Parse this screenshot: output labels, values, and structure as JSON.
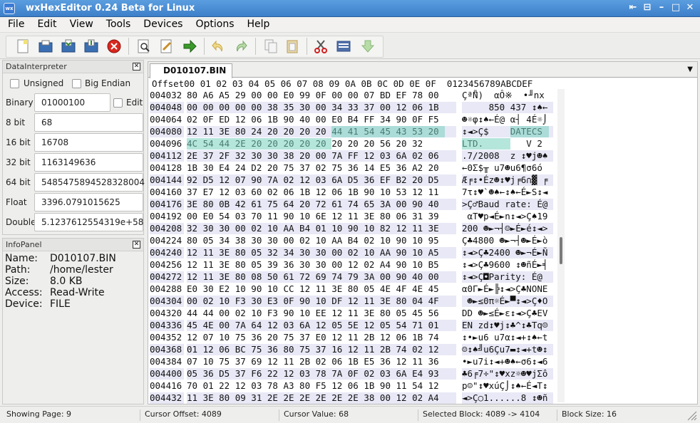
{
  "window": {
    "title": "wxHexEditor 0.24 Beta for Linux",
    "icon_text": "wx"
  },
  "menu": [
    "File",
    "Edit",
    "View",
    "Tools",
    "Devices",
    "Options",
    "Help"
  ],
  "toolbar": [
    "new-file",
    "open-file",
    "save-file",
    "save-as",
    "close-file",
    "find",
    "find-replace",
    "goto-offset",
    "undo",
    "redo",
    "copy",
    "paste",
    "cut",
    "device-memory",
    "download"
  ],
  "data_interpreter": {
    "title": "DataInterpreter",
    "unsigned_label": "Unsigned",
    "big_endian_label": "Big Endian",
    "edit_label": "Edit",
    "rows": [
      {
        "label": "Binary",
        "value": "01000100"
      },
      {
        "label": "8 bit",
        "value": "68"
      },
      {
        "label": "16 bit",
        "value": "16708"
      },
      {
        "label": "32 bit",
        "value": "1163149636"
      },
      {
        "label": "64 bit",
        "value": "5485475894528328004"
      },
      {
        "label": "Float",
        "value": "3396.0791015625"
      },
      {
        "label": "Double",
        "value": "5.1237612554319e+58"
      }
    ]
  },
  "info_panel": {
    "title": "InfoPanel",
    "rows": [
      {
        "key": "Name:",
        "value": "D010107.BIN"
      },
      {
        "key": "Path:",
        "value": "/home/lester"
      },
      {
        "key": "Size:",
        "value": "8.0 KB"
      },
      {
        "key": "Access:",
        "value": "Read-Write"
      },
      {
        "key": "Device:",
        "value": "FILE"
      }
    ]
  },
  "hex_view": {
    "tab": "D010107.BIN",
    "header": "Offset00 01 02 03 04 05 06 07 08 09 0A 0B 0C 0D 0E 0F  0123456789ABCDEF",
    "rows": [
      {
        "offset": "004032",
        "hex": "80 A6 A5 29 00 00 E0 99 0F 00 00 07 BD EF 78 00",
        "text": "Çª̃Ñ)  αÔ※  •╜nx"
      },
      {
        "offset": "004048",
        "hex": "00 00 00 00 00 38 35 30 00 34 33 37 00 12 06 1B",
        "text": "     850 437 ↕♠←"
      },
      {
        "offset": "004064",
        "hex": "02 0F ED 12 06 1B 90 40 00 E0 B4 FF 34 90 0F F5",
        "text": "☻☼φ↕♠←É@ α┤ 4É☼⌡"
      },
      {
        "offset": "004080",
        "hex": "12 11 3E 80 24 20 20 20 20 44 41 54 45 43 53 20",
        "text": "↕◄>Ç$    DATECS "
      },
      {
        "offset": "004096",
        "hex": "4C 54 44 2E 20 20 20 20 20 20 20 20 56 20 32",
        "text": "LTD.        V 2"
      },
      {
        "offset": "004112",
        "hex": "2E 37 2F 32 30 30 38 20 00 7A FF 12 03 6A 02 06",
        "text": ".7/2008  z ↕♥j☻♠"
      },
      {
        "offset": "004128",
        "hex": "1B 30 E4 24 D2 20 75 37 02 75 36 14 E5 36 A2 20",
        "text": "←0Σ$╥ u7☻u6¶σ6ó "
      },
      {
        "offset": "004144",
        "hex": "92 D5 12 07 90 7A 02 12 03 6A D5 36 EF B2 20 D5",
        "text": "Æ╒↕•Éz☻↕♥j╒6∩▓ ╒"
      },
      {
        "offset": "004160",
        "hex": "37 E7 12 03 60 02 06 1B 12 06 1B 90 10 53 12 11",
        "text": "7τ↕♥`☻♠←↕♠←É►S↕◄"
      },
      {
        "offset": "004176",
        "hex": "3E 80 0B 42 61 75 64 20 72 61 74 65 3A 00 90 40",
        "text": ">Ç♂Baud rate: É@"
      },
      {
        "offset": "004192",
        "hex": "00 E0 54 03 70 11 90 10 6E 12 11 3E 80 06 31 39",
        "text": " αT♥p◄É►n↕◄>Ç♠19"
      },
      {
        "offset": "004208",
        "hex": "32 30 30 00 02 10 AA B4 01 10 90 10 82 12 11 3E",
        "text": "200 ☻►¬┤☺►É►é↕◄>"
      },
      {
        "offset": "004224",
        "hex": "80 05 34 38 30 30 00 02 10 AA B4 02 10 90 10 95",
        "text": "Ç♣4800 ☻►¬┤☻►É►ò"
      },
      {
        "offset": "004240",
        "hex": "12 11 3E 80 05 32 34 30 30 00 02 10 AA 90 10 A5",
        "text": "↕◄>Ç♣2400 ☻►¬É►Ñ"
      },
      {
        "offset": "004256",
        "hex": "12 11 3E 80 05 39 36 30 30 00 12 02 A4 90 10 B5",
        "text": "↕◄>Ç♣9600 ↕☻ñÉ►╡"
      },
      {
        "offset": "004272",
        "hex": "12 11 3E 80 08 50 61 72 69 74 79 3A 00 90 40 00",
        "text": "↕◄>Ç◘Parity: É@ "
      },
      {
        "offset": "004288",
        "hex": "E0 30 E2 10 90 10 CC 12 11 3E 80 05 4E 4F 4E 45",
        "text": "α0Γ►É►╠↕◄>Ç♣NONE"
      },
      {
        "offset": "004304",
        "hex": "00 02 10 F3 30 E3 0F 90 10 DF 12 11 3E 80 04 4F",
        "text": " ☻►≤0π☼É►▀↕◄>Ç♦O"
      },
      {
        "offset": "004320",
        "hex": "44 44 00 02 10 F3 90 10 EE 12 11 3E 80 05 45 56",
        "text": "DD ☻►≤É►ε↕◄>Ç♣EV"
      },
      {
        "offset": "004336",
        "hex": "45 4E 00 7A 64 12 03 6A 12 05 5E 12 05 54 71 01",
        "text": "EN zd↕♥j↕♣^↕♣Tq☺"
      },
      {
        "offset": "004352",
        "hex": "12 07 10 75 36 20 75 37 E0 12 11 2B 12 06 1B 74",
        "text": "↕•►u6 u7α↕◄+↕♠←t"
      },
      {
        "offset": "004368",
        "hex": "01 12 06 BC 75 36 80 75 37 16 12 11 2B 74 02 12",
        "text": "☺↕♠╝u6Çu7▬↕◄+t☻↕"
      },
      {
        "offset": "004384",
        "hex": "07 10 75 37 69 12 11 2B 02 06 1B E5 36 12 11 36",
        "text": "•►u7i↕◄+☻♠←σ6↕◄6"
      },
      {
        "offset": "004400",
        "fill": "",
        "hex": "05 36 D5 37 F6 22 12 03 78 7A 0F 02 03 6A E4 93",
        "text": "♣6╒7÷\"↕♥xz☼☻♥jΣô"
      },
      {
        "offset": "004416",
        "hex": "70 01 22 12 03 78 A3 80 F5 12 06 1B 90 11 54 12",
        "text": "p☺\"↕♥xúÇ⌡↕♠←É◄T↕"
      },
      {
        "offset": "004432",
        "hex": "11 3E 80 09 31 2E 2E 2E 2E 2E 2E 38 00 12 02 A4",
        "text": "◄>Ç○1......8 ↕☻ñ"
      }
    ]
  },
  "status": {
    "page": "Showing Page: 9",
    "cursor_offset": "Cursor Offset: 4089",
    "cursor_value": "Cursor Value: 68",
    "selected_block": "Selected Block: 4089 -> 4104",
    "block_size": "Block Size: 16"
  },
  "colors": {
    "selection": "#79d1bf",
    "alt_row": "#e8e8f6",
    "titlebar": "#4a8fd9"
  }
}
